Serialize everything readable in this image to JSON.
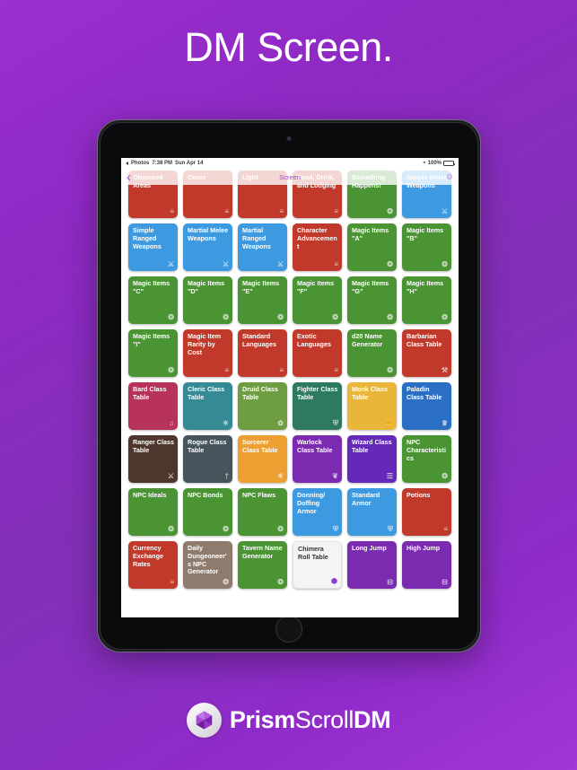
{
  "poster": {
    "headline": "DM Screen.",
    "background_color": "#8e29c4"
  },
  "device": {
    "type": "tablet",
    "status_bar": {
      "back_app": "Photos",
      "time": "7:38 PM",
      "date": "Sun Apr 14",
      "battery_percent": "100%",
      "wifi_icon": "wifi-icon",
      "battery_icon": "battery-icon"
    },
    "nav_bar": {
      "back_icon": "chevron-left-icon",
      "title": "Screen",
      "settings_icon": "gear-icon"
    }
  },
  "grid": {
    "tiles": [
      {
        "label": "Obscured Areas",
        "color": "#c0392b",
        "icon": "table-icon",
        "glyph": "≡"
      },
      {
        "label": "Cover",
        "color": "#c0392b",
        "icon": "table-icon",
        "glyph": "≡"
      },
      {
        "label": "Light",
        "color": "#c0392b",
        "icon": "table-icon",
        "glyph": "≡"
      },
      {
        "label": "Food, Drink, and Lodging",
        "color": "#c0392b",
        "icon": "table-icon",
        "glyph": "≡"
      },
      {
        "label": "Something Happens!",
        "color": "#4a9434",
        "icon": "dice-icon",
        "glyph": "❂"
      },
      {
        "label": "Simple Melee Weapons",
        "color": "#3d9ae0",
        "icon": "weapon-icon",
        "glyph": "⚔"
      },
      {
        "label": "Simple Ranged Weapons",
        "color": "#3d9ae0",
        "icon": "weapon-icon",
        "glyph": "⚔"
      },
      {
        "label": "Martial Melee Weapons",
        "color": "#3d9ae0",
        "icon": "weapon-icon",
        "glyph": "⚔"
      },
      {
        "label": "Martial Ranged Weapons",
        "color": "#3d9ae0",
        "icon": "weapon-icon",
        "glyph": "⚔"
      },
      {
        "label": "Character Advancement",
        "color": "#c0392b",
        "icon": "table-icon",
        "glyph": "≡"
      },
      {
        "label": "Magic Items \"A\"",
        "color": "#4a9434",
        "icon": "dice-icon",
        "glyph": "❂"
      },
      {
        "label": "Magic Items \"B\"",
        "color": "#4a9434",
        "icon": "dice-icon",
        "glyph": "❂"
      },
      {
        "label": "Magic Items \"C\"",
        "color": "#4a9434",
        "icon": "dice-icon",
        "glyph": "❂"
      },
      {
        "label": "Magic Items \"D\"",
        "color": "#4a9434",
        "icon": "dice-icon",
        "glyph": "❂"
      },
      {
        "label": "Magic Items \"E\"",
        "color": "#4a9434",
        "icon": "dice-icon",
        "glyph": "❂"
      },
      {
        "label": "Magic Items \"F\"",
        "color": "#4a9434",
        "icon": "dice-icon",
        "glyph": "❂"
      },
      {
        "label": "Magic Items \"G\"",
        "color": "#4a9434",
        "icon": "dice-icon",
        "glyph": "❂"
      },
      {
        "label": "Magic Items \"H\"",
        "color": "#4a9434",
        "icon": "dice-icon",
        "glyph": "❂"
      },
      {
        "label": "Magic Items \"I\"",
        "color": "#4a9434",
        "icon": "dice-icon",
        "glyph": "❂"
      },
      {
        "label": "Magic Item Rarity by Cost",
        "color": "#c0392b",
        "icon": "table-icon",
        "glyph": "≡"
      },
      {
        "label": "Standard Languages",
        "color": "#c0392b",
        "icon": "table-icon",
        "glyph": "≡"
      },
      {
        "label": "Exotic Languages",
        "color": "#c0392b",
        "icon": "table-icon",
        "glyph": "≡"
      },
      {
        "label": "d20 Name Generator",
        "color": "#4a9434",
        "icon": "dice-icon",
        "glyph": "❂"
      },
      {
        "label": "Barbarian Class Table",
        "color": "#c0392b",
        "icon": "axe-icon",
        "glyph": "⚒"
      },
      {
        "label": "Bard Class Table",
        "color": "#b8335a",
        "icon": "lute-icon",
        "glyph": "♫"
      },
      {
        "label": "Cleric Class Table",
        "color": "#358a95",
        "icon": "sun-icon",
        "glyph": "☀"
      },
      {
        "label": "Druid Class Table",
        "color": "#6f9e42",
        "icon": "leaf-icon",
        "glyph": "✿"
      },
      {
        "label": "Fighter Class Table",
        "color": "#2d7a5f",
        "icon": "shield-icon",
        "glyph": "⛨"
      },
      {
        "label": "Monk Class Table",
        "color": "#eab63a",
        "icon": "fist-icon",
        "glyph": "✊"
      },
      {
        "label": "Paladin Class Table",
        "color": "#2a6fc4",
        "icon": "crown-icon",
        "glyph": "♛"
      },
      {
        "label": "Ranger Class Table",
        "color": "#4e362c",
        "icon": "bow-icon",
        "glyph": "⚔"
      },
      {
        "label": "Rogue Class Table",
        "color": "#46545c",
        "icon": "dagger-icon",
        "glyph": "†"
      },
      {
        "label": "Sorcerer Class Table",
        "color": "#eda031",
        "icon": "spark-icon",
        "glyph": "☀"
      },
      {
        "label": "Warlock Class Table",
        "color": "#7a2bb0",
        "icon": "eye-icon",
        "glyph": "❦"
      },
      {
        "label": "Wizard Class Table",
        "color": "#6429b8",
        "icon": "book-icon",
        "glyph": "☰"
      },
      {
        "label": "NPC Characteristics",
        "color": "#4a9434",
        "icon": "dice-icon",
        "glyph": "❂"
      },
      {
        "label": "NPC Ideals",
        "color": "#4a9434",
        "icon": "dice-icon",
        "glyph": "❂"
      },
      {
        "label": "NPC Bonds",
        "color": "#4a9434",
        "icon": "dice-icon",
        "glyph": "❂"
      },
      {
        "label": "NPC Flaws",
        "color": "#4a9434",
        "icon": "dice-icon",
        "glyph": "❂"
      },
      {
        "label": "Donning/ Doffing Armor",
        "color": "#3d9ae0",
        "icon": "armor-icon",
        "glyph": "⛨"
      },
      {
        "label": "Standard Armor",
        "color": "#3d9ae0",
        "icon": "armor-icon",
        "glyph": "⛨"
      },
      {
        "label": "Potions",
        "color": "#c0392b",
        "icon": "table-icon",
        "glyph": "≡"
      },
      {
        "label": "Currency Exchange Rates",
        "color": "#c0392b",
        "icon": "table-icon",
        "glyph": "≡"
      },
      {
        "label": "Daily Dungeoneer's NPC Generator",
        "color": "#8d7c6e",
        "icon": "dice-icon",
        "glyph": "❂"
      },
      {
        "label": "Tavern Name Generator",
        "color": "#4a9434",
        "icon": "dice-icon",
        "glyph": "❂"
      },
      {
        "label": "Chimera Roll Table",
        "color": "#f4f4f6",
        "icon": "app-icon",
        "glyph": "⬢",
        "light": true
      },
      {
        "label": "Long Jump",
        "color": "#7a2bb0",
        "icon": "calc-icon",
        "glyph": "⊟"
      },
      {
        "label": "High Jump",
        "color": "#7a2bb0",
        "icon": "calc-icon",
        "glyph": "⊟"
      }
    ]
  },
  "brand": {
    "word1": "Prism",
    "word2": "Scroll",
    "word3": "DM",
    "logo_icon": "prism-hex-logo"
  }
}
